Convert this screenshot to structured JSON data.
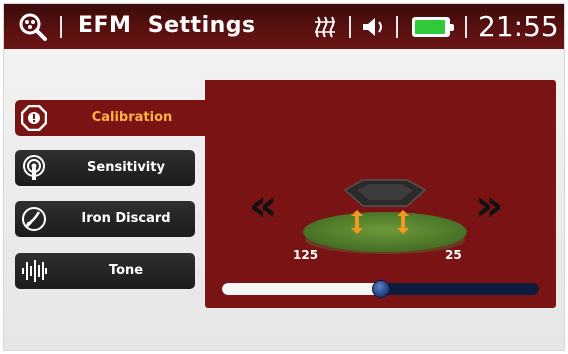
{
  "app": {
    "title": "EFM  Settings"
  },
  "status": {
    "time": "21:55",
    "battery_level": 1.0,
    "battery_color": "#30c93a",
    "icons": [
      "search-icon",
      "signal-icon",
      "speaker-icon",
      "battery-icon"
    ]
  },
  "menu": {
    "items": [
      {
        "label": "Calibration",
        "icon": "calibration-icon",
        "active": true
      },
      {
        "label": "Sensitivity",
        "icon": "sensitivity-icon",
        "active": false
      },
      {
        "label": "Iron Discard",
        "icon": "iron-discard-icon",
        "active": false
      },
      {
        "label": "Tone",
        "icon": "tone-icon",
        "active": false
      }
    ]
  },
  "calibration": {
    "left_value": "125",
    "right_value": "25",
    "slider_position": 0.5
  },
  "colors": {
    "accent": "#7a1414",
    "active_label": "#ffb347",
    "slider_fill": "#f5f5f5",
    "slider_track": "#0e1c40"
  }
}
